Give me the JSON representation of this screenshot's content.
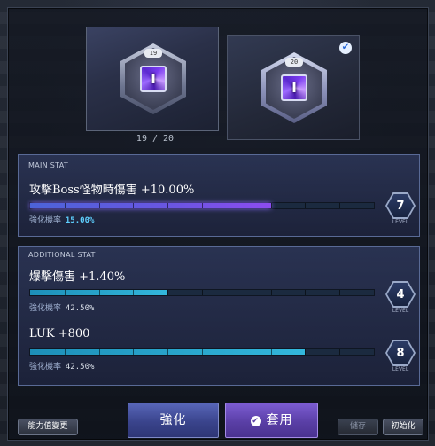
{
  "slots": {
    "current": {
      "level_tag": "19",
      "gem_glyph": "I",
      "icon": "purple-gem-icon"
    },
    "next": {
      "level_tag": "20",
      "gem_glyph": "I",
      "icon": "purple-gem-icon",
      "check_glyph": "✔"
    },
    "count": "19 / 20"
  },
  "main_stat": {
    "section_label": "MAIN STAT",
    "name": "攻擊Boss怪物時傷害 +10.00%",
    "progress": 0.7,
    "chance_label": "強化機率",
    "chance_value": "15.00%",
    "level": "7",
    "level_caption": "LEVEL"
  },
  "additional_stat": {
    "section_label": "ADDITIONAL STAT",
    "rows": [
      {
        "name": "爆擊傷害 +1.40%",
        "progress": 0.4,
        "chance_label": "強化機率",
        "chance_value": "42.50%",
        "level": "4",
        "level_caption": "LEVEL"
      },
      {
        "name": "LUK +800",
        "progress": 0.8,
        "chance_label": "強化機率",
        "chance_value": "42.50%",
        "level": "8",
        "level_caption": "LEVEL"
      }
    ]
  },
  "buttons": {
    "change_ability": "能力值變更",
    "enhance": "強化",
    "apply": "套用",
    "apply_icon": "✔",
    "save": "儲存",
    "reset": "初始化"
  },
  "colors": {
    "accent_purple": "#8c4cf0",
    "accent_teal": "#33b7dc",
    "chance_highlight": "#5fd0ff"
  }
}
